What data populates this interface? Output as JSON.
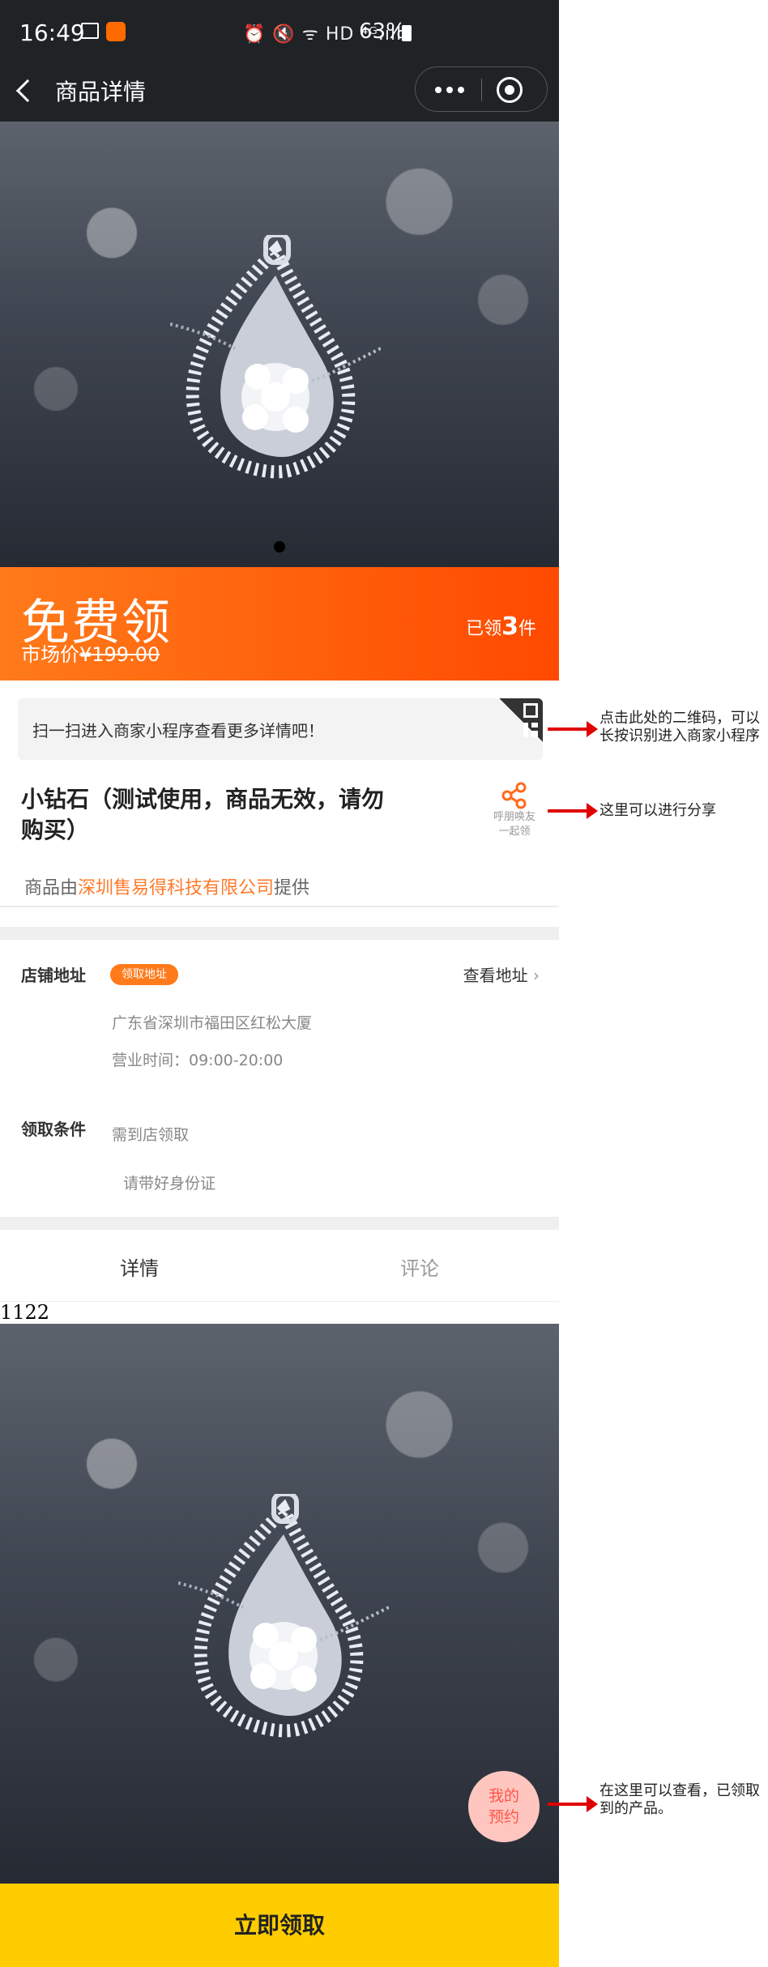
{
  "status_bar": {
    "time": "16:49",
    "system_icons": "⏰ 🔇 ᯤ HD ⁴ᴳ.ıll",
    "battery": "63%"
  },
  "nav": {
    "title": "商品详情",
    "back_icon": "chevron-left-icon",
    "more_icon": "more-dots-icon",
    "target_icon": "target-icon"
  },
  "banner": {
    "headline": "免费领",
    "market_label": "市场价",
    "market_price": "¥199.00",
    "claimed_prefix": "已领",
    "claimed_count": "3",
    "claimed_suffix": "件"
  },
  "qr_strip": {
    "text": "扫一扫进入商家小程序查看更多详情吧！"
  },
  "product": {
    "title": "小钻石（测试使用，商品无效，请勿购买）",
    "share_label_1": "呼朋唤友",
    "share_label_2": "一起领"
  },
  "provider": {
    "prefix": "商品由",
    "company": "深圳售易得科技有限公司",
    "suffix": "提供"
  },
  "store": {
    "address_label": "店铺地址",
    "tag": "领取地址",
    "view_address": "查看地址",
    "address": "广东省深圳市福田区红松大厦",
    "hours": "营业时间：09:00-20:00",
    "condition_label": "领取条件",
    "condition_1": "需到店领取",
    "condition_2": "请带好身份证"
  },
  "tabs": {
    "details": "详情",
    "comments": "评论"
  },
  "raw_text": "1122",
  "my_reservation_1": "我的",
  "my_reservation_2": "预约",
  "cta": "立即领取",
  "annotations": {
    "qr_note": "点击此处的二维码，可以长按识别进入商家小程序",
    "share_note": "这里可以进行分享",
    "reservation_note": "在这里可以查看，已领取到的产品。"
  },
  "colors": {
    "accent": "#ff6a00",
    "cta": "#ffcc00",
    "arrow": "#e00000"
  }
}
